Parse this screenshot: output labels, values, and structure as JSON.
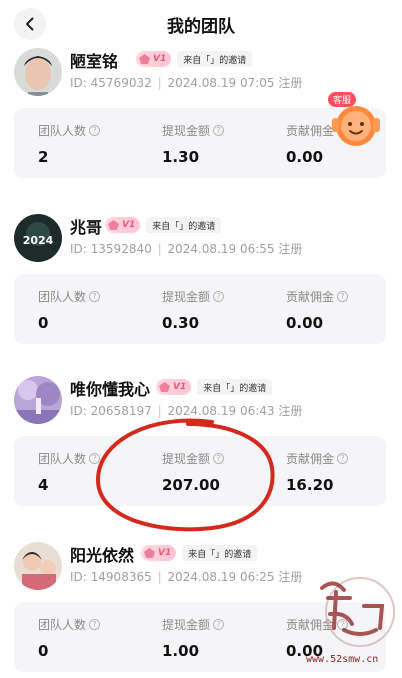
{
  "header": {
    "title": "我的团队",
    "back_icon": "chevron-left-icon"
  },
  "service_button": {
    "badge": "客服",
    "icon": "orange-mascot-icon"
  },
  "stat_labels": {
    "team_count": "团队人数",
    "withdraw": "提现金额",
    "commission": "贡献佣金"
  },
  "members": [
    {
      "name": "陋室铭",
      "level": "V1",
      "invite": "来自「」的邀请",
      "id_label": "ID:",
      "id": "45769032",
      "registered": "2024.08.19 07:05",
      "register_suffix": "注册",
      "team_count": "2",
      "withdraw": "1.30",
      "commission": "0.00"
    },
    {
      "name": "兆哥",
      "level": "V1",
      "invite": "来自「」的邀请",
      "id_label": "ID:",
      "id": "13592840",
      "registered": "2024.08.19 06:55",
      "register_suffix": "注册",
      "avatar_text": "2024",
      "team_count": "0",
      "withdraw": "0.30",
      "commission": "0.00"
    },
    {
      "name": "唯你懂我心",
      "level": "V1",
      "invite": "来自「」的邀请",
      "id_label": "ID:",
      "id": "20658197",
      "registered": "2024.08.19 06:43",
      "register_suffix": "注册",
      "team_count": "4",
      "withdraw": "207.00",
      "commission": "16.20"
    },
    {
      "name": "阳光依然",
      "level": "V1",
      "invite": "来自「」的邀请",
      "id_label": "ID:",
      "id": "14908365",
      "registered": "2024.08.19 06:25",
      "register_suffix": "注册",
      "team_count": "0",
      "withdraw": "1.00",
      "commission": "0.00"
    }
  ],
  "watermark": {
    "url": "www.52smw.cn"
  },
  "colors": {
    "accent_pink": "#e8577b",
    "card_bg": "#f5f5f7",
    "annotation_red": "#d42a1e"
  }
}
